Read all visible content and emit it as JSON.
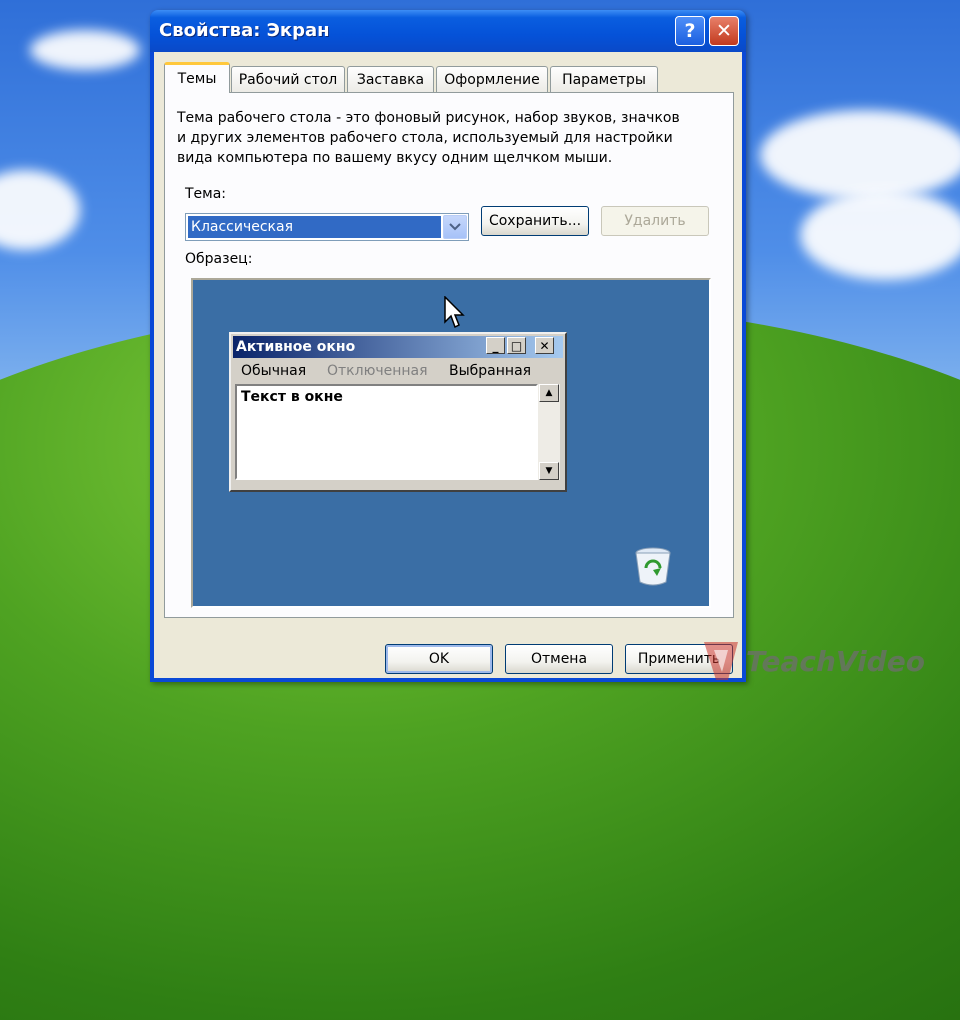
{
  "window": {
    "title": "Свойства: Экран",
    "help_glyph": "?",
    "close_glyph": "✕"
  },
  "tabs": [
    {
      "label": "Темы",
      "active": true
    },
    {
      "label": "Рабочий стол",
      "active": false
    },
    {
      "label": "Заставка",
      "active": false
    },
    {
      "label": "Оформление",
      "active": false
    },
    {
      "label": "Параметры",
      "active": false
    }
  ],
  "themes": {
    "description_lines": [
      "Тема рабочего стола - это фоновый рисунок, набор звуков, значков",
      "и других элементов рабочего стола, используемый для настройки",
      "вида компьютера по вашему вкусу одним щелчком мыши."
    ],
    "theme_label": "Тема:",
    "theme_value": "Классическая",
    "save_label": "Сохранить...",
    "delete_label": "Удалить",
    "sample_label": "Образец:"
  },
  "preview": {
    "window_title": "Активное окно",
    "menu": [
      "Обычная",
      "Отключенная",
      "Выбранная"
    ],
    "window_text": "Текст в окне",
    "min_glyph": "_",
    "max_glyph": "□",
    "close_glyph": "✕",
    "background_color": "#3a6ea5"
  },
  "buttons": {
    "ok": "OK",
    "cancel": "Отмена",
    "apply": "Применить"
  },
  "watermark": "TeachVideo",
  "colors": {
    "title_bar": "#0552d8",
    "selection": "#316ac5",
    "tab_highlight": "#ffc83c"
  }
}
